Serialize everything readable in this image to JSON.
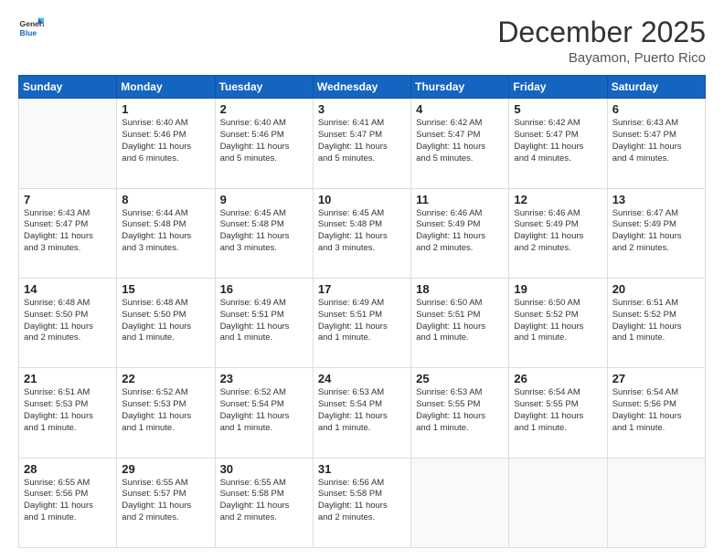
{
  "header": {
    "logo_general": "General",
    "logo_blue": "Blue",
    "month_year": "December 2025",
    "location": "Bayamon, Puerto Rico"
  },
  "days_of_week": [
    "Sunday",
    "Monday",
    "Tuesday",
    "Wednesday",
    "Thursday",
    "Friday",
    "Saturday"
  ],
  "weeks": [
    [
      {
        "num": "",
        "info": ""
      },
      {
        "num": "1",
        "info": "Sunrise: 6:40 AM\nSunset: 5:46 PM\nDaylight: 11 hours\nand 6 minutes."
      },
      {
        "num": "2",
        "info": "Sunrise: 6:40 AM\nSunset: 5:46 PM\nDaylight: 11 hours\nand 5 minutes."
      },
      {
        "num": "3",
        "info": "Sunrise: 6:41 AM\nSunset: 5:47 PM\nDaylight: 11 hours\nand 5 minutes."
      },
      {
        "num": "4",
        "info": "Sunrise: 6:42 AM\nSunset: 5:47 PM\nDaylight: 11 hours\nand 5 minutes."
      },
      {
        "num": "5",
        "info": "Sunrise: 6:42 AM\nSunset: 5:47 PM\nDaylight: 11 hours\nand 4 minutes."
      },
      {
        "num": "6",
        "info": "Sunrise: 6:43 AM\nSunset: 5:47 PM\nDaylight: 11 hours\nand 4 minutes."
      }
    ],
    [
      {
        "num": "7",
        "info": "Sunrise: 6:43 AM\nSunset: 5:47 PM\nDaylight: 11 hours\nand 3 minutes."
      },
      {
        "num": "8",
        "info": "Sunrise: 6:44 AM\nSunset: 5:48 PM\nDaylight: 11 hours\nand 3 minutes."
      },
      {
        "num": "9",
        "info": "Sunrise: 6:45 AM\nSunset: 5:48 PM\nDaylight: 11 hours\nand 3 minutes."
      },
      {
        "num": "10",
        "info": "Sunrise: 6:45 AM\nSunset: 5:48 PM\nDaylight: 11 hours\nand 3 minutes."
      },
      {
        "num": "11",
        "info": "Sunrise: 6:46 AM\nSunset: 5:49 PM\nDaylight: 11 hours\nand 2 minutes."
      },
      {
        "num": "12",
        "info": "Sunrise: 6:46 AM\nSunset: 5:49 PM\nDaylight: 11 hours\nand 2 minutes."
      },
      {
        "num": "13",
        "info": "Sunrise: 6:47 AM\nSunset: 5:49 PM\nDaylight: 11 hours\nand 2 minutes."
      }
    ],
    [
      {
        "num": "14",
        "info": "Sunrise: 6:48 AM\nSunset: 5:50 PM\nDaylight: 11 hours\nand 2 minutes."
      },
      {
        "num": "15",
        "info": "Sunrise: 6:48 AM\nSunset: 5:50 PM\nDaylight: 11 hours\nand 1 minute."
      },
      {
        "num": "16",
        "info": "Sunrise: 6:49 AM\nSunset: 5:51 PM\nDaylight: 11 hours\nand 1 minute."
      },
      {
        "num": "17",
        "info": "Sunrise: 6:49 AM\nSunset: 5:51 PM\nDaylight: 11 hours\nand 1 minute."
      },
      {
        "num": "18",
        "info": "Sunrise: 6:50 AM\nSunset: 5:51 PM\nDaylight: 11 hours\nand 1 minute."
      },
      {
        "num": "19",
        "info": "Sunrise: 6:50 AM\nSunset: 5:52 PM\nDaylight: 11 hours\nand 1 minute."
      },
      {
        "num": "20",
        "info": "Sunrise: 6:51 AM\nSunset: 5:52 PM\nDaylight: 11 hours\nand 1 minute."
      }
    ],
    [
      {
        "num": "21",
        "info": "Sunrise: 6:51 AM\nSunset: 5:53 PM\nDaylight: 11 hours\nand 1 minute."
      },
      {
        "num": "22",
        "info": "Sunrise: 6:52 AM\nSunset: 5:53 PM\nDaylight: 11 hours\nand 1 minute."
      },
      {
        "num": "23",
        "info": "Sunrise: 6:52 AM\nSunset: 5:54 PM\nDaylight: 11 hours\nand 1 minute."
      },
      {
        "num": "24",
        "info": "Sunrise: 6:53 AM\nSunset: 5:54 PM\nDaylight: 11 hours\nand 1 minute."
      },
      {
        "num": "25",
        "info": "Sunrise: 6:53 AM\nSunset: 5:55 PM\nDaylight: 11 hours\nand 1 minute."
      },
      {
        "num": "26",
        "info": "Sunrise: 6:54 AM\nSunset: 5:55 PM\nDaylight: 11 hours\nand 1 minute."
      },
      {
        "num": "27",
        "info": "Sunrise: 6:54 AM\nSunset: 5:56 PM\nDaylight: 11 hours\nand 1 minute."
      }
    ],
    [
      {
        "num": "28",
        "info": "Sunrise: 6:55 AM\nSunset: 5:56 PM\nDaylight: 11 hours\nand 1 minute."
      },
      {
        "num": "29",
        "info": "Sunrise: 6:55 AM\nSunset: 5:57 PM\nDaylight: 11 hours\nand 2 minutes."
      },
      {
        "num": "30",
        "info": "Sunrise: 6:55 AM\nSunset: 5:58 PM\nDaylight: 11 hours\nand 2 minutes."
      },
      {
        "num": "31",
        "info": "Sunrise: 6:56 AM\nSunset: 5:58 PM\nDaylight: 11 hours\nand 2 minutes."
      },
      {
        "num": "",
        "info": ""
      },
      {
        "num": "",
        "info": ""
      },
      {
        "num": "",
        "info": ""
      }
    ]
  ]
}
